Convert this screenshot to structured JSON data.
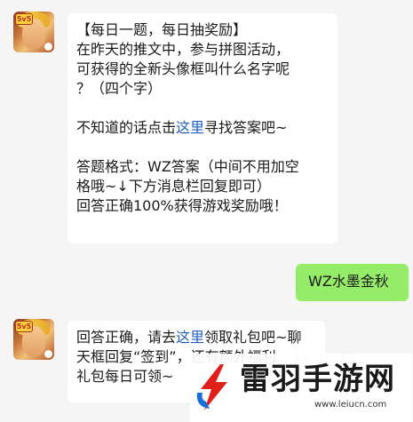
{
  "messages": {
    "m1": {
      "line1": "【每日一题，每日抽奖励】",
      "line2": "在昨天的推文中，参与拼图活动，",
      "line3": "可获得的全新头像框叫什么名字呢",
      "line4": "？（四个字）",
      "line5_pre": "不知道的话点击",
      "line5_link": "这里",
      "line5_post": "寻找答案吧~",
      "line6": "答题格式：WZ答案（中间不用加空",
      "line7": "格哦~↓下方消息栏回复即可）",
      "line8": "回答正确100%获得游戏奖励哦！"
    },
    "m2": {
      "text": "WZ水墨金秋"
    },
    "m3": {
      "line1_pre": "回答正确，请去",
      "line1_link": "这里",
      "line1_post": "领取礼包吧~聊",
      "line2": "天框回复“签到”，还有额外福利",
      "line3": "礼包每日可领~"
    }
  },
  "avatar": {
    "badge": "5v5"
  },
  "watermark": {
    "title": "雷羽手游网",
    "url": "www.leiucn.com"
  },
  "colors": {
    "user_bubble": "#95ec69",
    "link": "#1f5fc4",
    "background": "#f5f5f5",
    "logo_red": "#e0201b",
    "logo_blue": "#1a6fd6"
  }
}
